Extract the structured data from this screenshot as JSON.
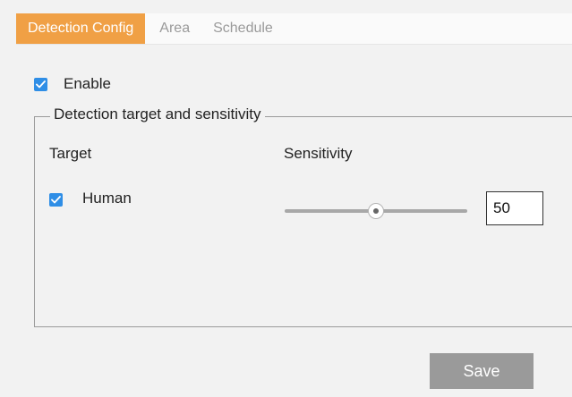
{
  "tabs": [
    {
      "label": "Detection Config",
      "active": true
    },
    {
      "label": "Area",
      "active": false
    },
    {
      "label": "Schedule",
      "active": false
    }
  ],
  "enable": {
    "label": "Enable",
    "checked": true
  },
  "group": {
    "legend": "Detection target and sensitivity"
  },
  "columns": {
    "target": "Target",
    "sensitivity": "Sensitivity"
  },
  "target_human": {
    "label": "Human",
    "checked": true
  },
  "sensitivity": {
    "value": "50",
    "min": 0,
    "max": 100,
    "level": 0.5
  },
  "save_label": "Save",
  "colors": {
    "accent_tab": "#f0a045",
    "checkbox": "#2f8ee6",
    "save_button": "#9a9a9a",
    "background": "#f2f2f2"
  }
}
